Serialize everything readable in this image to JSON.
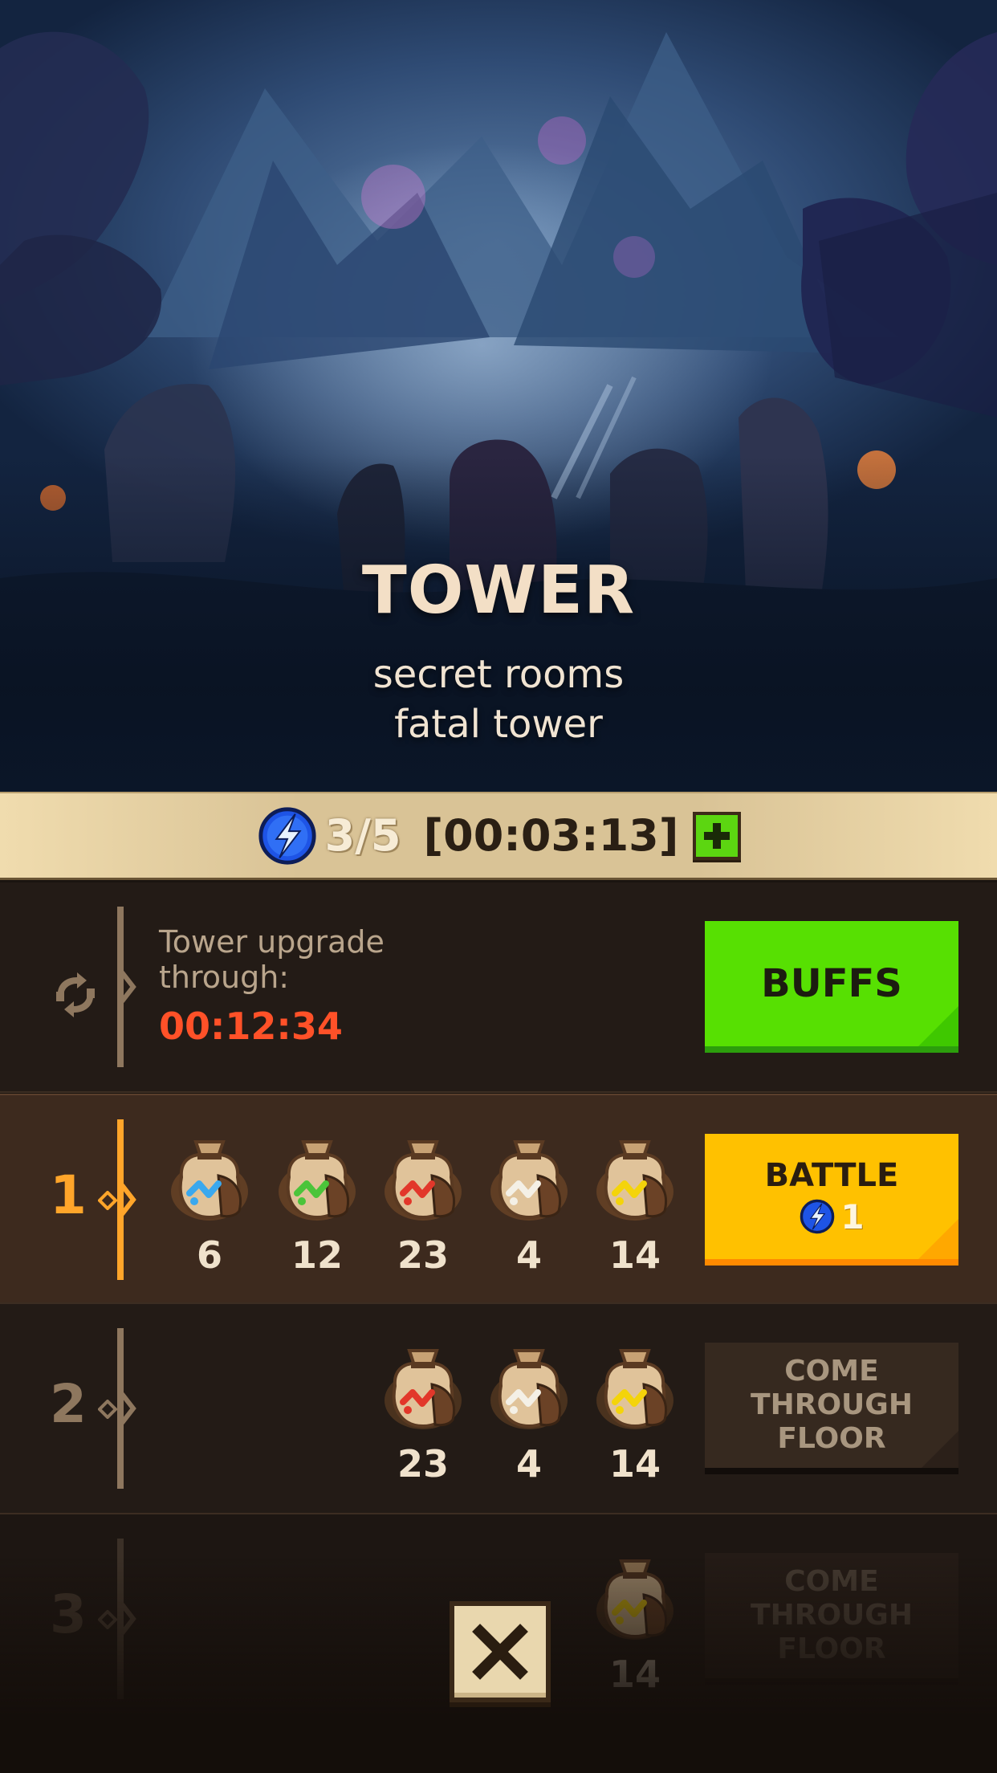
{
  "hero": {
    "title": "TOWER",
    "subtitle_line1": "secret rooms",
    "subtitle_line2": "fatal tower"
  },
  "energy": {
    "icon": "energy-bolt-icon",
    "count": "3/5",
    "timer": "[00:03:13]",
    "add_icon": "plus-icon"
  },
  "upgrade": {
    "icon": "refresh-icon",
    "label": "Tower upgrade through:",
    "timer": "00:12:34",
    "buffs_label": "BUFFS"
  },
  "floors": [
    {
      "number": "1",
      "active": true,
      "rewards": [
        {
          "type": "blue-rune-bag-icon",
          "count": "6"
        },
        {
          "type": "green-rune-bag-icon",
          "count": "12"
        },
        {
          "type": "red-rune-bag-icon",
          "count": "23"
        },
        {
          "type": "white-rune-bag-icon",
          "count": "4"
        },
        {
          "type": "yellow-rune-bag-icon",
          "count": "14"
        }
      ],
      "button_label": "BATTLE",
      "button_cost": "1"
    },
    {
      "number": "2",
      "active": false,
      "rewards": [
        {
          "type": "red-rune-bag-icon",
          "count": "23"
        },
        {
          "type": "white-rune-bag-icon",
          "count": "4"
        },
        {
          "type": "yellow-rune-bag-icon",
          "count": "14"
        }
      ],
      "button_label_line1": "COME THROUGH",
      "button_label_line2": "FLOOR"
    },
    {
      "number": "3",
      "active": false,
      "rewards": [
        {
          "type": "yellow-rune-bag-icon",
          "count": "14"
        }
      ],
      "button_label_line1": "COME THROUGH",
      "button_label_line2": "FLOOR"
    }
  ],
  "close_icon": "close-icon",
  "colors": {
    "accent_orange": "#ffa52a",
    "timer_red": "#ff5128",
    "buffs_green": "#57e002",
    "battle_yellow": "#ffc100",
    "energy_blue": "#2a6cff"
  }
}
